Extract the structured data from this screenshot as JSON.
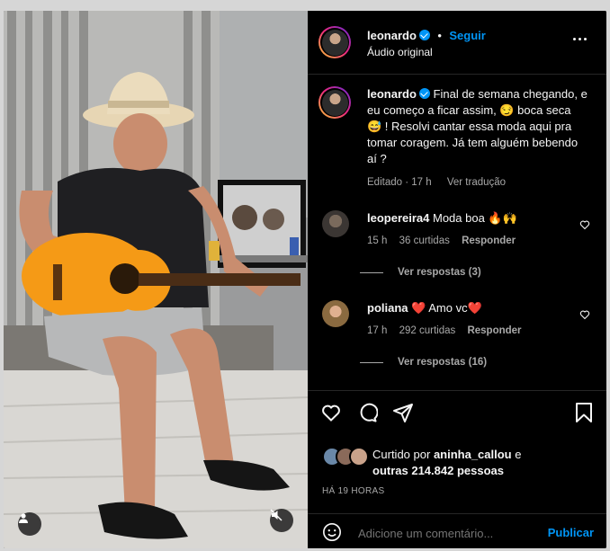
{
  "post": {
    "username": "leonardo",
    "follow_label": "Seguir",
    "separator": "•",
    "audio_label": "Áudio original"
  },
  "caption": {
    "username": "leonardo",
    "text": "Final de semana chegando, e eu começo a ficar assim, 😏 boca seca 😅 ! Resolvi cantar essa moda aqui pra tomar coragem. Já tem alguém bebendo aí ?",
    "edited": "Editado",
    "time": "17 h",
    "see_translation": "Ver tradução"
  },
  "comments": [
    {
      "username": "leopereira4",
      "text": "Moda boa 🔥🙌",
      "time": "15 h",
      "likes": "36 curtidas",
      "reply": "Responder",
      "replies": "Ver respostas (3)"
    },
    {
      "username": "poliana",
      "text": "❤️ Amo vc❤️",
      "time": "17 h",
      "likes": "292 curtidas",
      "reply": "Responder",
      "replies": "Ver respostas (16)"
    }
  ],
  "likes": {
    "prefix": "Curtido por",
    "user": "aninha_callou",
    "and": "e",
    "others": "outras 214.842 pessoas"
  },
  "posted_ago": "HÁ 19 HORAS",
  "comment_box": {
    "placeholder": "Adicione um comentário...",
    "publish": "Publicar"
  },
  "colors": {
    "accent": "#0095f6",
    "background": "#000000",
    "muted": "#a8a8a8",
    "heart": "#ff3040"
  },
  "icons": [
    "more-icon",
    "verified-icon",
    "heart-icon",
    "comment-icon",
    "share-icon",
    "bookmark-icon",
    "emoji-icon",
    "user-tag-icon",
    "mute-icon"
  ]
}
